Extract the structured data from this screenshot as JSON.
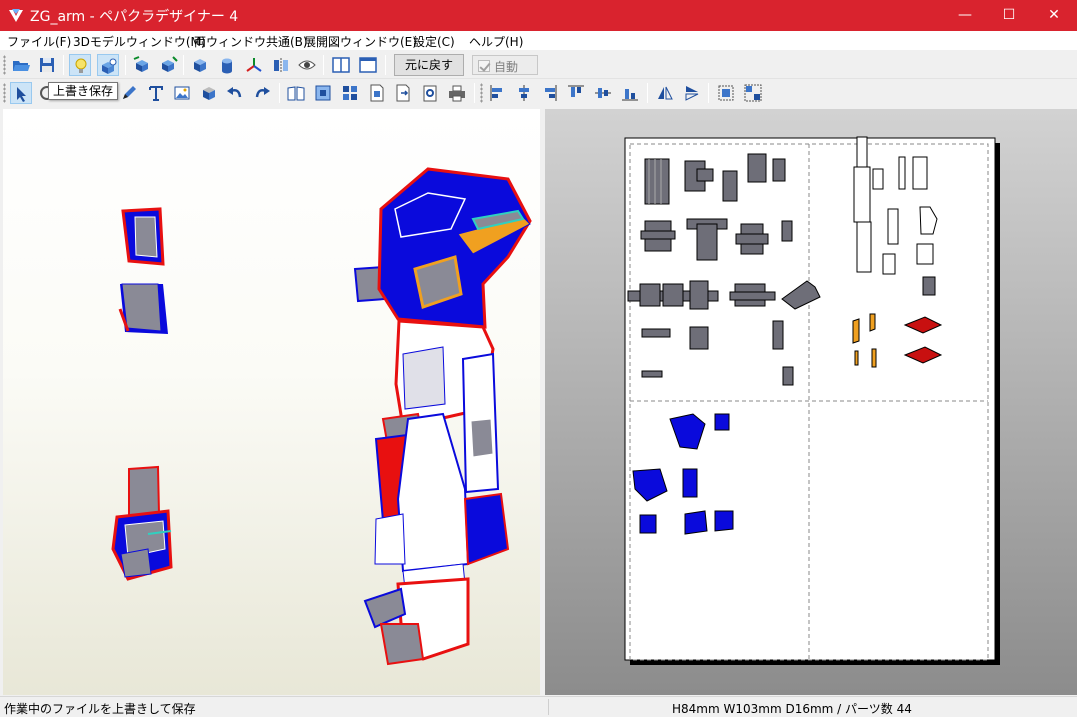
{
  "window": {
    "title": "ZG_arm - ペパクラデザイナー 4",
    "minimize": "—",
    "maximize": "☐",
    "close": "✕"
  },
  "menu": [
    "ファイル(F)",
    "3Dモデルウィンドウ(M)",
    "両ウィンドウ共通(B)",
    "展開図ウィンドウ(E)",
    "設定(C)",
    "ヘルプ(H)"
  ],
  "toolbar": {
    "revert_label": "元に戻す",
    "auto_label": "自動",
    "auto_checked": true
  },
  "tooltip": "上書き保存",
  "status": {
    "message": "作業中のファイルを上書きして保存",
    "dimensions": "H84mm W103mm D16mm / パーツ数 44"
  },
  "colors": {
    "titlebar": "#d9232e",
    "part_blue": "#0a0adc",
    "part_red": "#e81010",
    "part_gray": "#8a8a96",
    "tab_orange": "#f0a020"
  }
}
